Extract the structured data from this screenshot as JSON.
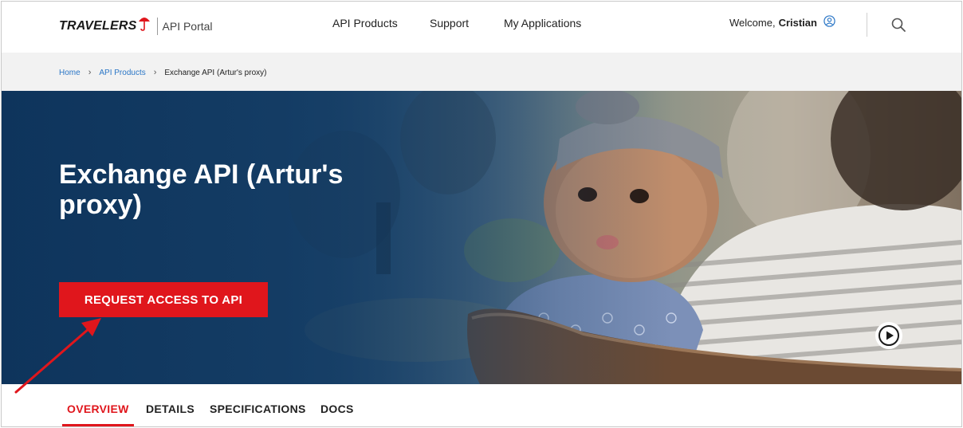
{
  "header": {
    "logo_text": "TRAVELERS",
    "portal_label": "API Portal",
    "nav": [
      {
        "label": "API Products"
      },
      {
        "label": "Support"
      },
      {
        "label": "My Applications"
      }
    ],
    "welcome_prefix": "Welcome,",
    "user_name": "Cristian"
  },
  "breadcrumb": {
    "items": [
      "Home",
      "API Products"
    ],
    "current": "Exchange API (Artur's proxy)"
  },
  "hero": {
    "title": "Exchange API (Artur's proxy)",
    "request_button": "REQUEST ACCESS TO API"
  },
  "tabs": [
    {
      "label": "OVERVIEW",
      "active": true
    },
    {
      "label": "DETAILS",
      "active": false
    },
    {
      "label": "SPECIFICATIONS",
      "active": false
    },
    {
      "label": "DOCS",
      "active": false
    }
  ],
  "icons": {
    "logo": "umbrella-icon",
    "user": "user-circle-icon",
    "search": "search-icon",
    "play": "play-circle-icon",
    "annotation": "red-arrow-annotation"
  },
  "colors": {
    "brand_red": "#e0161c",
    "link_blue": "#2a76c6",
    "hero_navy": "#10395f",
    "crumb_bg": "#f2f2f2"
  }
}
